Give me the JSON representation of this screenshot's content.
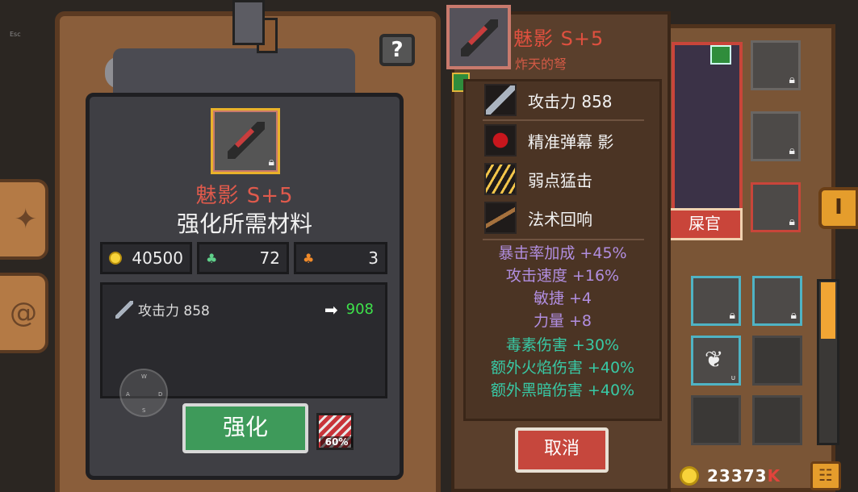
{
  "hud": {
    "esc_label": "Esc",
    "help_label": "?",
    "joystick": {
      "w": "W",
      "a": "A",
      "s": "S",
      "d": "D"
    }
  },
  "forge": {
    "item_name": "魅影 S+5",
    "materials_title": "强化所需材料",
    "resources": [
      {
        "icon": "gold-coin-icon",
        "value": "40500"
      },
      {
        "icon": "green-gem-icon",
        "value": "72"
      },
      {
        "icon": "orange-gem-icon",
        "value": "3"
      }
    ],
    "stat": {
      "label": "攻击力 858",
      "new_value": "908"
    },
    "enhance_button": "强化",
    "success_rate": "60%"
  },
  "tooltip": {
    "name": "魅影 S+5",
    "subtitle": "炸天的弩",
    "attributes": [
      {
        "icon": "sword-icon",
        "text": "攻击力 858"
      },
      {
        "icon": "red-swirl-icon",
        "text": "精准弹幕 影"
      },
      {
        "icon": "gold-strike-icon",
        "text": "弱点猛击"
      },
      {
        "icon": "wand-icon",
        "text": "法术回响"
      }
    ],
    "bonuses": [
      {
        "text": "暴击率加成 +45%",
        "color": "purple"
      },
      {
        "text": "攻击速度 +16%",
        "color": "purple"
      },
      {
        "text": "敏捷 +4",
        "color": "purple"
      },
      {
        "text": "力量 +8",
        "color": "purple"
      },
      {
        "text": "毒素伤害 +30%",
        "color": "teal"
      },
      {
        "text": "额外火焰伤害 +40%",
        "color": "teal"
      },
      {
        "text": "额外黑暗伤害 +40%",
        "color": "teal"
      }
    ],
    "cancel_button": "取消"
  },
  "inventory": {
    "name_badge": "屎官",
    "tab_label": "I",
    "gold_amount": "23373",
    "gold_suffix": "K",
    "item_tag": "U",
    "menu_label": "☷"
  },
  "colors": {
    "accent_red": "#e0503f",
    "enhance_green": "#3e9a5a",
    "new_stat_green": "#3ee24b",
    "bonus_purple": "#b18ee0",
    "bonus_teal": "#38c9a5"
  }
}
